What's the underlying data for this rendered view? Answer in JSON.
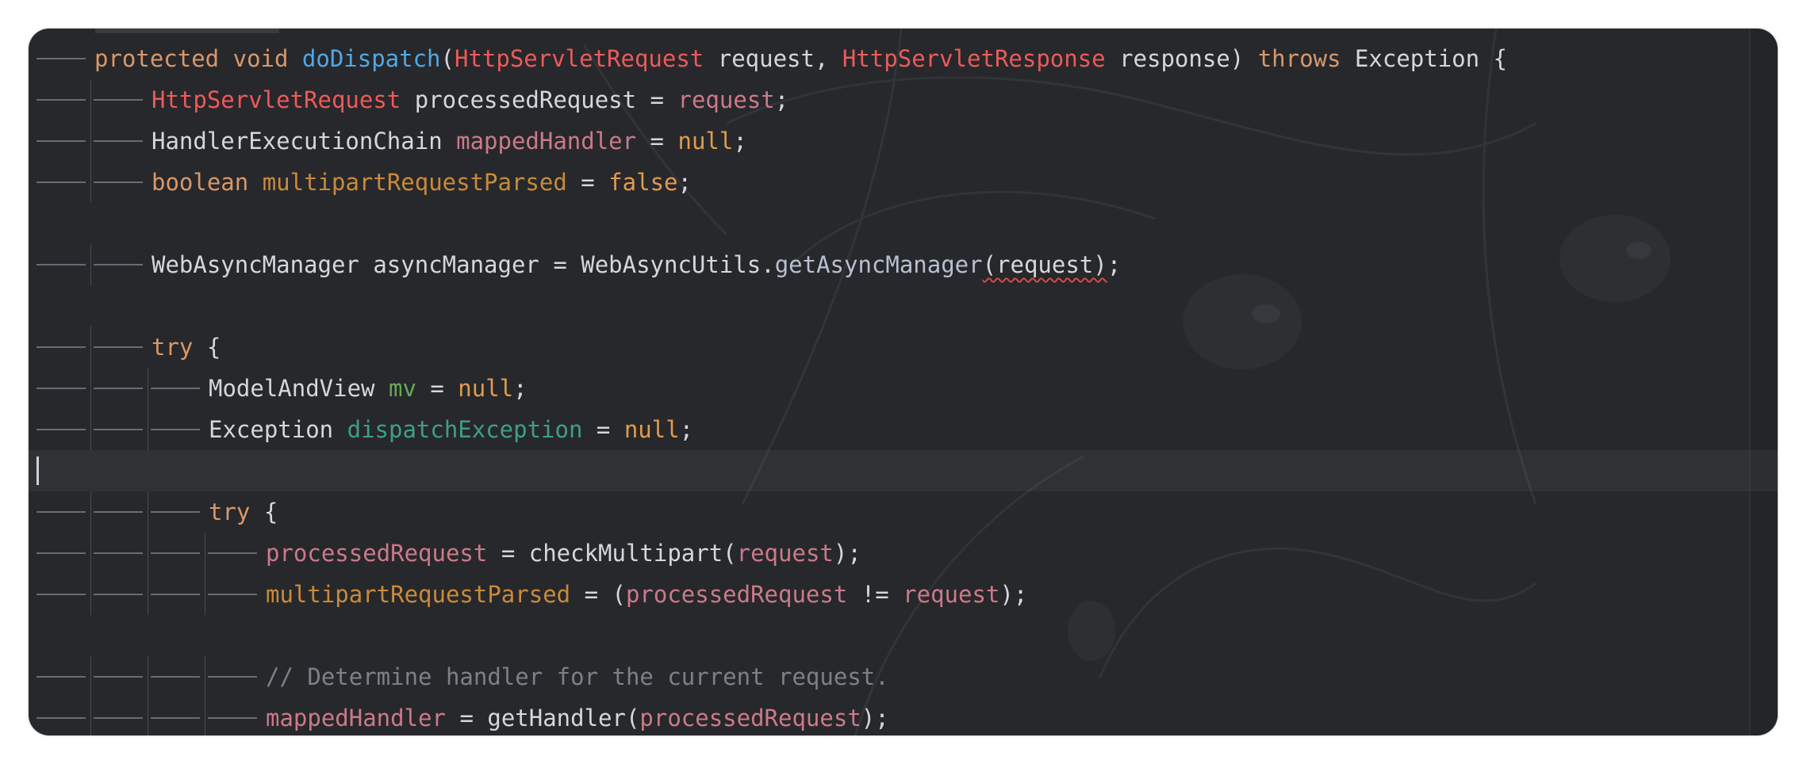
{
  "editor": {
    "colors": {
      "background": "#27282b",
      "keyword": "#d9986a",
      "function": "#4fa8e8",
      "type_highlight": "#ec5a5a",
      "field_red": "#cb7a8a",
      "field_orange": "#c98b3a",
      "field_green": "#67a85a",
      "field_teal": "#3f9e8a",
      "literal": "#e29a4f",
      "comment": "#7d8088"
    },
    "lines": [
      {
        "indent": 1,
        "tokens": [
          {
            "t": "protected",
            "c": "kw"
          },
          {
            "t": " ",
            "c": "plain"
          },
          {
            "t": "void",
            "c": "kw"
          },
          {
            "t": " ",
            "c": "plain"
          },
          {
            "t": "doDispatch",
            "c": "fn"
          },
          {
            "t": "(",
            "c": "plain"
          },
          {
            "t": "HttpServletRequest",
            "c": "type-r"
          },
          {
            "t": " request, ",
            "c": "plain"
          },
          {
            "t": "HttpServletResponse",
            "c": "type-r"
          },
          {
            "t": " response) ",
            "c": "plain"
          },
          {
            "t": "throws",
            "c": "kw"
          },
          {
            "t": " Exception {",
            "c": "plain"
          }
        ]
      },
      {
        "indent": 2,
        "tokens": [
          {
            "t": "HttpServletRequest",
            "c": "type-r"
          },
          {
            "t": " processedRequest = ",
            "c": "plain"
          },
          {
            "t": "request",
            "c": "field-r"
          },
          {
            "t": ";",
            "c": "plain"
          }
        ]
      },
      {
        "indent": 2,
        "tokens": [
          {
            "t": "HandlerExecutionChain ",
            "c": "plain"
          },
          {
            "t": "mappedHandler",
            "c": "field-r"
          },
          {
            "t": " = ",
            "c": "plain"
          },
          {
            "t": "null",
            "c": "lit"
          },
          {
            "t": ";",
            "c": "plain"
          }
        ]
      },
      {
        "indent": 2,
        "tokens": [
          {
            "t": "boolean",
            "c": "kw"
          },
          {
            "t": " ",
            "c": "plain"
          },
          {
            "t": "multipartRequestParsed",
            "c": "field-o"
          },
          {
            "t": " = ",
            "c": "plain"
          },
          {
            "t": "false",
            "c": "lit"
          },
          {
            "t": ";",
            "c": "plain"
          }
        ]
      },
      {
        "indent": 0,
        "tokens": []
      },
      {
        "indent": 2,
        "tokens": [
          {
            "t": "WebAsyncManager asyncManager = WebAsyncUtils.",
            "c": "plain"
          },
          {
            "t": "getAsyncManager",
            "c": "method"
          },
          {
            "t": "(request)",
            "c": "plain",
            "squiggle": true
          },
          {
            "t": ";",
            "c": "plain"
          }
        ]
      },
      {
        "indent": 0,
        "tokens": []
      },
      {
        "indent": 2,
        "tokens": [
          {
            "t": "try",
            "c": "kw"
          },
          {
            "t": " {",
            "c": "plain"
          }
        ]
      },
      {
        "indent": 3,
        "tokens": [
          {
            "t": "ModelAndView ",
            "c": "plain"
          },
          {
            "t": "mv",
            "c": "field-g"
          },
          {
            "t": " = ",
            "c": "plain"
          },
          {
            "t": "null",
            "c": "lit"
          },
          {
            "t": ";",
            "c": "plain"
          }
        ]
      },
      {
        "indent": 3,
        "tokens": [
          {
            "t": "Exception ",
            "c": "plain"
          },
          {
            "t": "dispatchException",
            "c": "field-t"
          },
          {
            "t": " = ",
            "c": "plain"
          },
          {
            "t": "null",
            "c": "lit"
          },
          {
            "t": ";",
            "c": "plain"
          }
        ]
      },
      {
        "indent": 0,
        "current": true,
        "tokens": []
      },
      {
        "indent": 3,
        "tokens": [
          {
            "t": "try",
            "c": "kw"
          },
          {
            "t": " {",
            "c": "plain"
          }
        ]
      },
      {
        "indent": 4,
        "tokens": [
          {
            "t": "processedRequest",
            "c": "field-r"
          },
          {
            "t": " = checkMultipart(",
            "c": "plain"
          },
          {
            "t": "request",
            "c": "field-r"
          },
          {
            "t": ");",
            "c": "plain"
          }
        ]
      },
      {
        "indent": 4,
        "tokens": [
          {
            "t": "multipartRequestParsed",
            "c": "field-o"
          },
          {
            "t": " = (",
            "c": "plain"
          },
          {
            "t": "processedRequest",
            "c": "field-r"
          },
          {
            "t": " != ",
            "c": "plain"
          },
          {
            "t": "request",
            "c": "field-r"
          },
          {
            "t": ");",
            "c": "plain"
          }
        ]
      },
      {
        "indent": 0,
        "tokens": []
      },
      {
        "indent": 4,
        "tokens": [
          {
            "t": "// Determine handler for the current request.",
            "c": "comment"
          }
        ]
      },
      {
        "indent": 4,
        "tokens": [
          {
            "t": "mappedHandler",
            "c": "field-r"
          },
          {
            "t": " = getHandler(",
            "c": "plain"
          },
          {
            "t": "processedRequest",
            "c": "field-r"
          },
          {
            "t": ");",
            "c": "plain"
          }
        ]
      }
    ]
  }
}
